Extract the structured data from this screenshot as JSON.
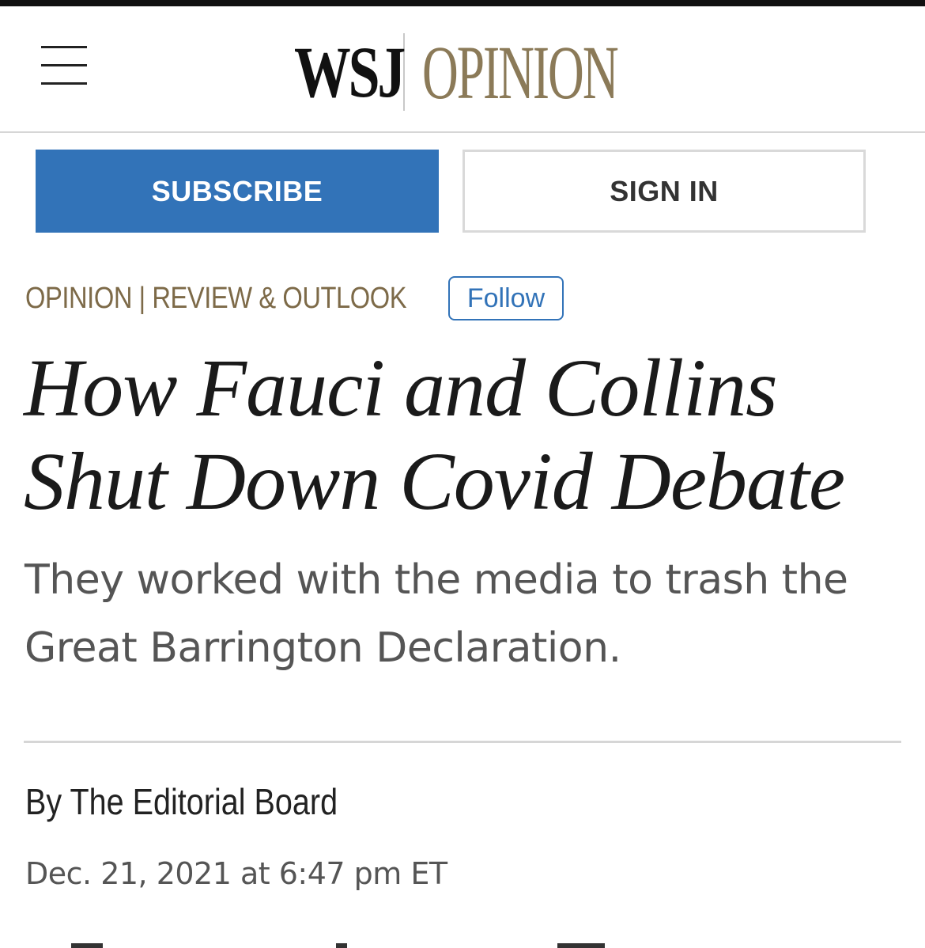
{
  "header": {
    "logo_wsj": "WSJ",
    "logo_section": "OPINION"
  },
  "actions": {
    "subscribe_label": "SUBSCRIBE",
    "signin_label": "SIGN IN"
  },
  "article": {
    "section_label": "OPINION | REVIEW & OUTLOOK",
    "follow_label": "Follow",
    "headline": "How Fauci and Collins Shut Down Covid Debate",
    "dek": "They worked with the media to trash the Great Barrington Declaration.",
    "byline": "By The Editorial Board",
    "dateline": "Dec. 21, 2021 at 6:47 pm ET"
  },
  "colors": {
    "brand_gold": "#8b7a58",
    "subscribe_blue": "#3273b8",
    "text_dark": "#1a1a1a",
    "text_gray": "#555555"
  },
  "icons": {
    "menu": "hamburger-menu-icon"
  }
}
